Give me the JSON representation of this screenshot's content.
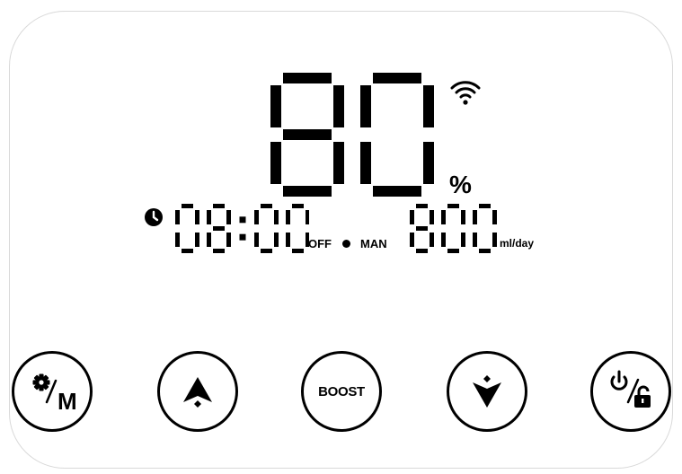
{
  "display": {
    "humidity": "80",
    "humidity_unit": "%",
    "time": "08:00",
    "timer_state": "OFF",
    "mode": "MAN",
    "output": "800",
    "output_unit": "ml/day"
  },
  "icons": {
    "wifi": "wifi-icon",
    "clock": "clock-icon",
    "status_dot": "dot-icon"
  },
  "buttons": {
    "mode": {
      "icon": "gear-icon",
      "label": "M"
    },
    "up": {
      "icon": "arrow-up-icon"
    },
    "boost": {
      "label": "BOOST"
    },
    "down": {
      "icon": "arrow-down-icon"
    },
    "power": {
      "icon": "power-lock-icon"
    }
  },
  "colors": {
    "segment": "#000000",
    "border": "#d9d9d9",
    "background": "#ffffff"
  }
}
